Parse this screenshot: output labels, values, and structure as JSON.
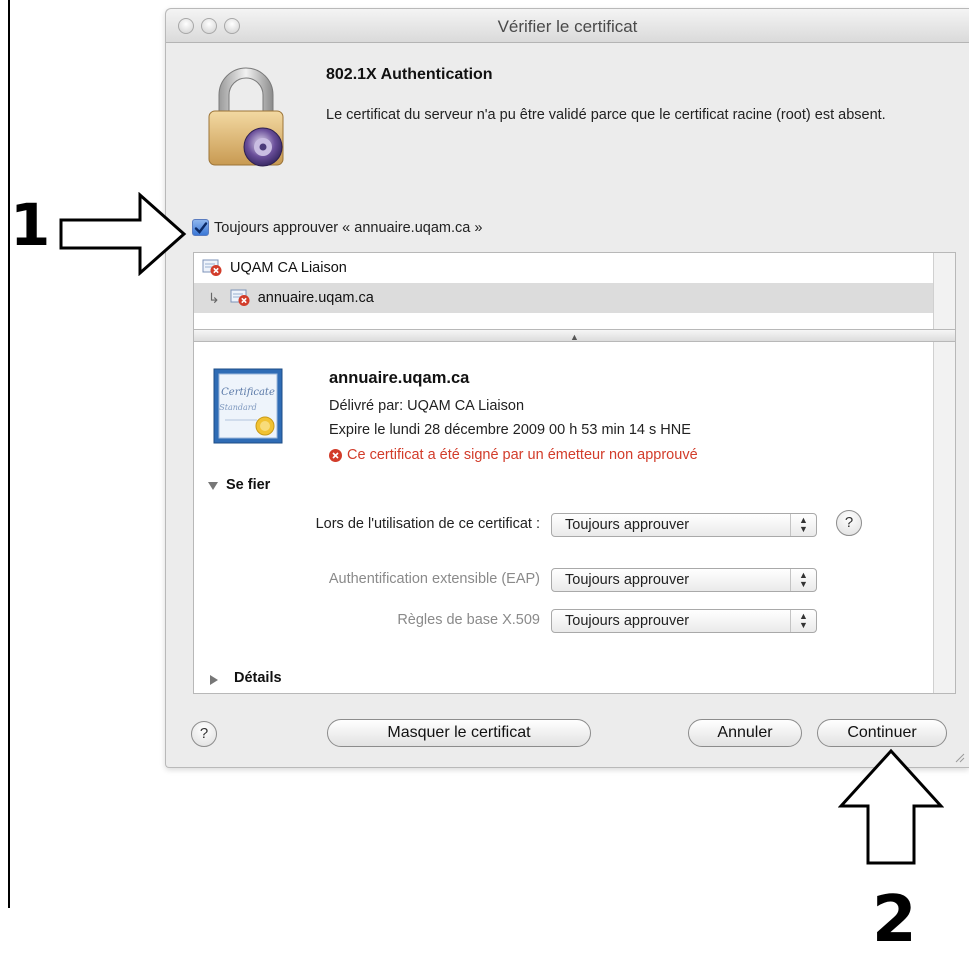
{
  "window": {
    "title": "Vérifier le certificat"
  },
  "header": {
    "auth_title": "802.1X Authentication",
    "auth_description": "Le certificat du serveur n'a pu être validé parce que le certificat racine (root) est absent."
  },
  "trust_checkbox": {
    "label": "Toujours approuver « annuaire.uqam.ca »",
    "checked": true
  },
  "chain": {
    "items": [
      {
        "label": "UQAM CA Liaison",
        "selected": false,
        "status_icon": "cert-error-icon"
      },
      {
        "label": "annuaire.uqam.ca",
        "selected": true,
        "status_icon": "cert-error-icon",
        "child_arrow": "↳"
      }
    ]
  },
  "detail": {
    "name": "annuaire.uqam.ca",
    "issuer": "Délivré par: UQAM CA Liaison",
    "expires": "Expire le lundi 28 décembre 2009 00 h 53 min 14 s HNE",
    "warning": "Ce certificat a été signé par un émetteur non approuvé",
    "cert_image_text_1": "Certificate",
    "cert_image_text_2": "Standard"
  },
  "trust_section": {
    "heading": "Se fier",
    "rows": [
      {
        "label": "Lors de l'utilisation de ce certificat :",
        "value": "Toujours approuver",
        "active": true
      },
      {
        "label": "Authentification extensible (EAP)",
        "value": "Toujours approuver",
        "active": false
      },
      {
        "label": "Règles de base X.509",
        "value": "Toujours approuver",
        "active": false
      }
    ]
  },
  "details_section": {
    "heading": "Détails"
  },
  "buttons": {
    "help": "?",
    "hide_certificate": "Masquer le certificat",
    "cancel": "Annuler",
    "continue": "Continuer"
  },
  "annotations": {
    "step_1": "1",
    "step_2": "2"
  },
  "colors": {
    "warning_red": "#d23c2a",
    "checkbox_blue": "#3b78d6",
    "selection_gray": "#dcdcdc"
  }
}
